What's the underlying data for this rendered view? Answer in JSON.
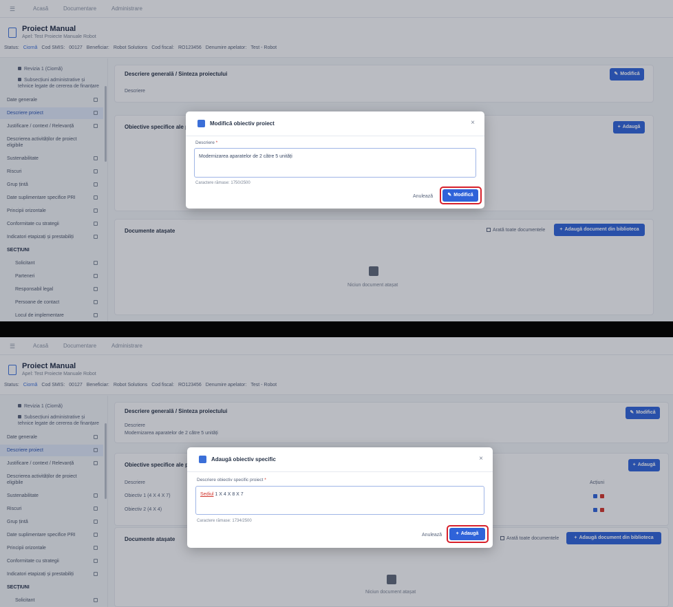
{
  "top_screen": {
    "nav": {
      "items": [
        "Acasă",
        "Documentare",
        "Administrare"
      ]
    },
    "header": {
      "title": "Proiect Manual",
      "subtitle": "Apel: Test Proiecte Manuale Robot",
      "info": [
        "Status:",
        "Ciornă",
        "Cod SMIS:",
        "00127",
        "Beneficiar:",
        "Robot Solutions",
        "Cod fiscal:",
        "RO123456",
        "Denumire apelator:",
        "Test - Robot"
      ]
    },
    "sidebar": {
      "top_items": [
        "Revizia 1 (Ciornă)",
        "Subsecțiuni administrative și tehnice legate de cererea de finanțare"
      ],
      "items": [
        "Date generale",
        "Descriere proiect",
        "Justificare / context / Relevanță",
        "Descrierea activităților de proiect eligibile",
        "Sustenabilitate",
        "Riscuri",
        "Grup țintă",
        "Date suplimentare specifice PRI",
        "Principii orizontale",
        "Conformitate cu strategii",
        "Indicatori etapizați și prestabiliți"
      ],
      "section": "SECȚIUNI",
      "sub_items": [
        "Solicitant",
        "Parteneri",
        "Responsabil legal",
        "Persoane de contact",
        "Locul de implementare"
      ]
    },
    "cards": {
      "general_title": "Descriere generală / Sinteza proiectului",
      "general_label": "Descriere",
      "edit_label": "Modifică",
      "specific_title": "Obiective specifice ale proiectului",
      "add_label": "Adaugă",
      "docs_title": "Documente atașate",
      "docs_checkbox": "Arată toate documentele",
      "docs_button": "Adaugă document din biblioteca",
      "empty_text": "Niciun document atașat"
    },
    "modal": {
      "title": "Modifică obiectiv proiect",
      "field_label": "Descriere",
      "field_value": "Modernizarea aparatelor de 2 către 5 unități",
      "hint": "Caractere rămase: 1750/2500",
      "cancel": "Anulează",
      "confirm": "Modifică"
    }
  },
  "bottom_screen": {
    "nav": {
      "items": [
        "Acasă",
        "Documentare",
        "Administrare"
      ]
    },
    "header": {
      "title": "Proiect Manual",
      "subtitle": "Apel: Test Proiecte Manuale Robot",
      "info": [
        "Status:",
        "Ciornă",
        "Cod SMIS:",
        "00127",
        "Beneficiar:",
        "Robot Solutions",
        "Cod fiscal:",
        "RO123456",
        "Denumire apelator:",
        "Test - Robot"
      ]
    },
    "sidebar": {
      "top_items": [
        "Revizia 1 (Ciornă)",
        "Subsecțiuni administrative și tehnice legate de cererea de finanțare"
      ],
      "items": [
        "Date generale",
        "Descriere proiect",
        "Justificare / context / Relevanță",
        "Descrierea activităților de proiect eligibile",
        "Sustenabilitate",
        "Riscuri",
        "Grup țintă",
        "Date suplimentare specifice PRI",
        "Principii orizontale",
        "Conformitate cu strategii",
        "Indicatori etapizați și prestabiliți"
      ],
      "section": "SECȚIUNI",
      "sub_items": [
        "Solicitant"
      ]
    },
    "cards": {
      "general_title": "Descriere generală / Sinteza proiectului",
      "general_label": "Descriere",
      "general_value": "Modernizarea aparatelor de 2 către 5 unități",
      "edit_label": "Modifică",
      "specific_title": "Obiective specifice ale proiectului",
      "add_label": "Adaugă",
      "table_header": "Descriere",
      "actions_header": "Acțiuni",
      "rows": [
        "Obiectiv 1 (4 X 4 X 7)",
        "Obiectiv 2 (4 X 4)"
      ],
      "docs_title": "Documente atașate",
      "docs_checkbox": "Arată toate documentele",
      "docs_button": "Adaugă document din biblioteca",
      "empty_text": "Niciun document atașat"
    },
    "modal": {
      "title": "Adaugă obiectiv specific",
      "field_label": "Descriere obiectiv specific proiect",
      "field_value_prefix": "Sediul",
      "field_value": " 1 X 4 X 8 X 7",
      "hint": "Caractere rămase: 1734/2500",
      "cancel": "Anulează",
      "confirm": "Adaugă"
    }
  },
  "colors": {
    "accent": "#2f63d9",
    "highlight": "#d71f2a",
    "separator": "#050505"
  }
}
